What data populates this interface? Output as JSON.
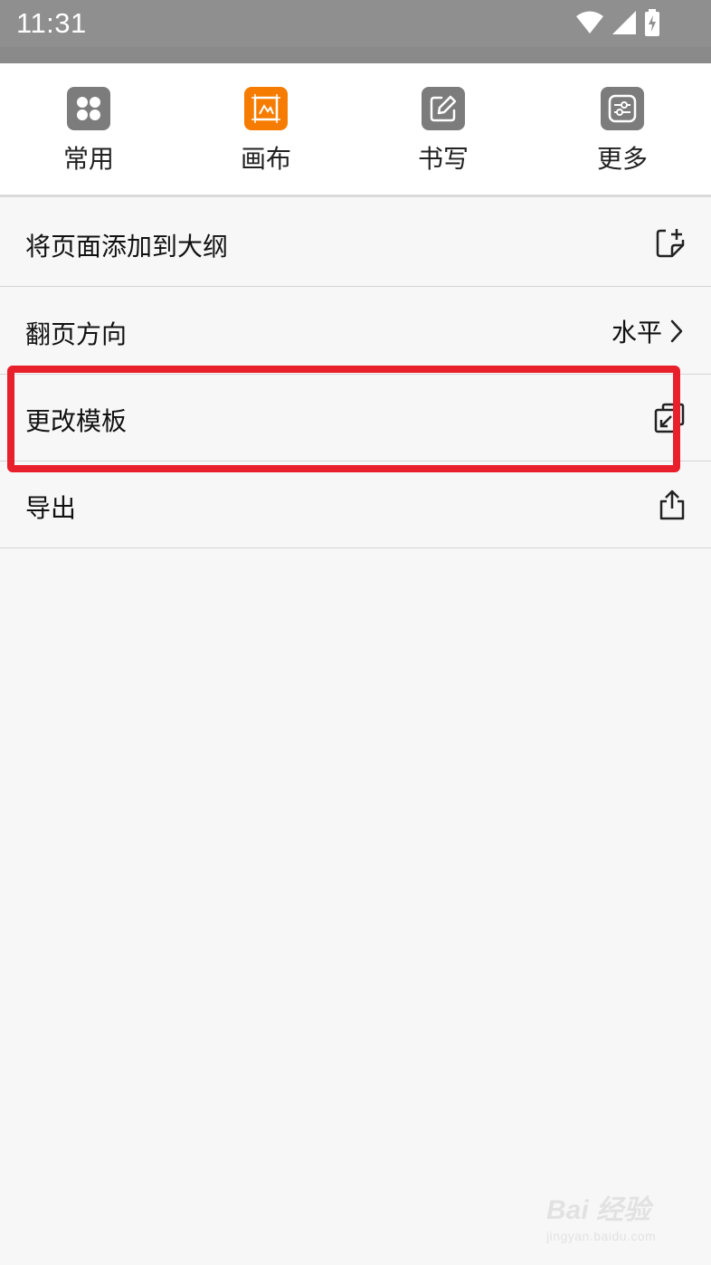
{
  "status_bar": {
    "time": "11:31",
    "icons": [
      "wifi-icon",
      "cell-signal-icon",
      "battery-charging-icon"
    ]
  },
  "tabs": [
    {
      "label": "常用",
      "icon": "grid-icon",
      "active": false
    },
    {
      "label": "画布",
      "icon": "canvas-icon",
      "active": true
    },
    {
      "label": "书写",
      "icon": "pen-icon",
      "active": false
    },
    {
      "label": "更多",
      "icon": "sliders-icon",
      "active": false
    }
  ],
  "menu": {
    "items": [
      {
        "label": "将页面添加到大纲",
        "icon": "add-to-outline-icon"
      },
      {
        "label": "翻页方向",
        "value": "水平",
        "icon": "chevron-right-icon"
      },
      {
        "label": "更改模板",
        "icon": "change-template-icon"
      },
      {
        "label": "导出",
        "icon": "share-export-icon"
      }
    ]
  },
  "watermark": {
    "brand": "Bai 经验",
    "url": "jingyan.baidu.com"
  },
  "colors": {
    "accent": "#f57c00",
    "highlight": "#e8202c",
    "status_bar": "#8f8f8f",
    "tab_icon_inactive": "#7c7c7c"
  }
}
